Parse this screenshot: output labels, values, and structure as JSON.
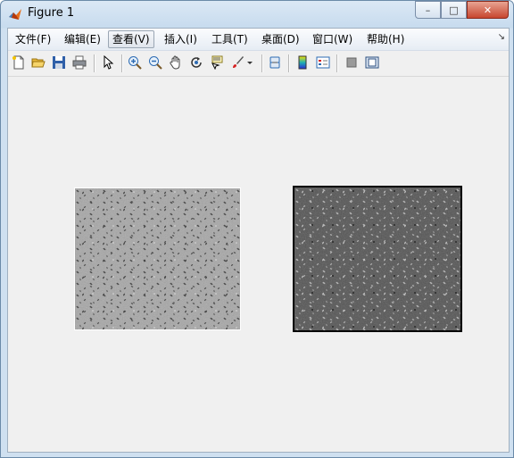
{
  "window": {
    "title": "Figure 1",
    "buttons": {
      "minimize": "–",
      "maximize": "□",
      "close": "✕"
    }
  },
  "menu": {
    "items": [
      "文件(F)",
      "编辑(E)",
      "查看(V)",
      "插入(I)",
      "工具(T)",
      "桌面(D)",
      "窗口(W)",
      "帮助(H)"
    ],
    "active_item": "查看(V)",
    "overflow": "↘"
  },
  "toolbar": {
    "icons": [
      "new-figure-icon",
      "open-file-icon",
      "save-icon",
      "print-icon",
      "select-arrow-icon",
      "zoom-in-icon",
      "zoom-out-icon",
      "pan-hand-icon",
      "rotate-3d-icon",
      "data-cursor-icon",
      "brush-icon",
      "dropdown-arrow-icon",
      "link-plot-icon",
      "colorbar-icon",
      "legend-icon",
      "hide-plot-tools-icon",
      "show-plot-tools-icon"
    ]
  },
  "figure": {
    "images": [
      {
        "name": "grayscale-cell-image",
        "tone": "light"
      },
      {
        "name": "dark-cell-image",
        "tone": "dark"
      }
    ]
  },
  "colors": {
    "background": "#f0f0f0",
    "title_gradient_top": "#dbe8f5",
    "close_button": "#c7462f"
  }
}
